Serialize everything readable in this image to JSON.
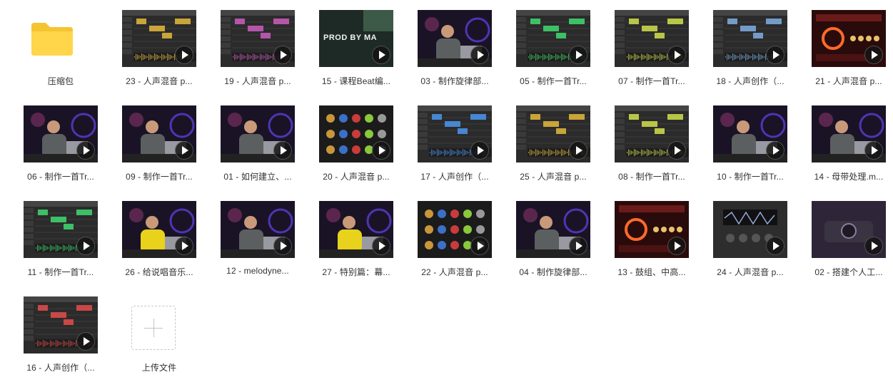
{
  "folder": {
    "label": "压缩包",
    "icon": "folder-icon"
  },
  "upload": {
    "label": "上传文件",
    "icon": "plus-icon"
  },
  "files": [
    {
      "label": "23 - 人声混音 p...",
      "scene": "daw-dark"
    },
    {
      "label": "19 - 人声混音 p...",
      "scene": "daw-pink"
    },
    {
      "label": "15 - 课程Beat编...",
      "scene": "prod-text",
      "overlay_text": "PROD BY MA"
    },
    {
      "label": "03 - 制作旋律部...",
      "scene": "studio"
    },
    {
      "label": "05 - 制作一首Tr...",
      "scene": "daw-green"
    },
    {
      "label": "07 - 制作一首Tr...",
      "scene": "daw-yellow"
    },
    {
      "label": "18 - 人声创作（...",
      "scene": "daw-grey"
    },
    {
      "label": "21 - 人声混音 p...",
      "scene": "plugin-red"
    },
    {
      "label": "06 - 制作一首Tr...",
      "scene": "studio"
    },
    {
      "label": "09 - 制作一首Tr...",
      "scene": "studio-close"
    },
    {
      "label": "01 - 如何建立、...",
      "scene": "studio"
    },
    {
      "label": "20 - 人声混音 p...",
      "scene": "plugin-rack"
    },
    {
      "label": "17 - 人声创作（...",
      "scene": "daw-blue"
    },
    {
      "label": "25 - 人声混音 p...",
      "scene": "daw-dark"
    },
    {
      "label": "08 - 制作一首Tr...",
      "scene": "daw-yellow"
    },
    {
      "label": "10 - 制作一首Tr...",
      "scene": "studio"
    },
    {
      "label": "14 - 母带处理.m...",
      "scene": "studio"
    },
    {
      "label": "11 - 制作一首Tr...",
      "scene": "daw-green"
    },
    {
      "label": "26 - 给说唱音乐...",
      "scene": "studio-yellow"
    },
    {
      "label": "12 - melodyne...",
      "scene": "studio"
    },
    {
      "label": "27 - 特别篇：幕...",
      "scene": "studio-yellow"
    },
    {
      "label": "22 - 人声混音 p...",
      "scene": "plugin-rack"
    },
    {
      "label": "04 - 制作旋律部...",
      "scene": "studio"
    },
    {
      "label": "13 - 鼓组、中高...",
      "scene": "plugin-red"
    },
    {
      "label": "24 - 人声混音 p...",
      "scene": "plugin-dark"
    },
    {
      "label": "02 - 搭建个人工...",
      "scene": "hardware"
    },
    {
      "label": "16 - 人声创作（...",
      "scene": "daw-red"
    }
  ]
}
